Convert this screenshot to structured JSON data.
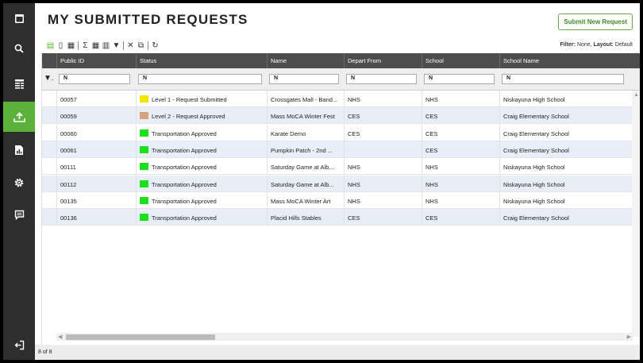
{
  "sidebar": {
    "items": [
      {
        "icon": "window-icon"
      },
      {
        "icon": "search-icon"
      },
      {
        "icon": "list-icon"
      },
      {
        "icon": "upload-icon",
        "active": true
      },
      {
        "icon": "report-icon"
      },
      {
        "icon": "gear-icon"
      },
      {
        "icon": "chat-icon"
      },
      {
        "icon": "logout-icon"
      }
    ],
    "active_color": "#5bb23a"
  },
  "header": {
    "title": "MY SUBMITTED REQUESTS",
    "submit_label": "Submit New Request"
  },
  "toolbar": {
    "filter_label": "Filter:",
    "filter_value": "None,",
    "layout_label": "Layout:",
    "layout_value": "Default"
  },
  "grid": {
    "columns": [
      "Public ID",
      "Status",
      "Name",
      "Depart From",
      "School",
      "School Name"
    ],
    "filter_placeholder": "N",
    "rows": [
      {
        "id": "00057",
        "status": "Level 1 - Request Submitted",
        "status_color": "#f5e400",
        "name": "Crossgates Mall - Band...",
        "depart": "NHS",
        "school": "NHS",
        "school_name": "Niskayuna High School"
      },
      {
        "id": "00059",
        "status": "Level 2 - Request Approved",
        "status_color": "#d9a07c",
        "name": "Mass MoCA Winter Fest",
        "depart": "CES",
        "school": "CES",
        "school_name": "Craig Elementary School"
      },
      {
        "id": "00060",
        "status": "Transportation Approved",
        "status_color": "#1de01d",
        "name": "Karate Demo",
        "depart": "CES",
        "school": "CES",
        "school_name": "Craig Elementary School"
      },
      {
        "id": "00061",
        "status": "Transportation Approved",
        "status_color": "#1de01d",
        "name": "Pumpkin Patch - 2nd ...",
        "depart": "",
        "school": "CES",
        "school_name": "Craig Elementary School"
      },
      {
        "id": "00111",
        "status": "Transportation Approved",
        "status_color": "#1de01d",
        "name": "Saturday Game at Alb...",
        "depart": "NHS",
        "school": "NHS",
        "school_name": "Niskayuna High School"
      },
      {
        "id": "00112",
        "status": "Transportation Approved",
        "status_color": "#1de01d",
        "name": "Saturday Game at Alb...",
        "depart": "NHS",
        "school": "NHS",
        "school_name": "Niskayuna High School"
      },
      {
        "id": "00135",
        "status": "Transportation Approved",
        "status_color": "#1de01d",
        "name": "Mass MoCA Winter Art",
        "depart": "NHS",
        "school": "NHS",
        "school_name": "Niskayuna High School"
      },
      {
        "id": "00136",
        "status": "Transportation Approved",
        "status_color": "#1de01d",
        "name": "Placid Hills Stables",
        "depart": "CES",
        "school": "CES",
        "school_name": "Craig Elementary School"
      }
    ]
  },
  "footer": {
    "count": "8 of 8"
  }
}
